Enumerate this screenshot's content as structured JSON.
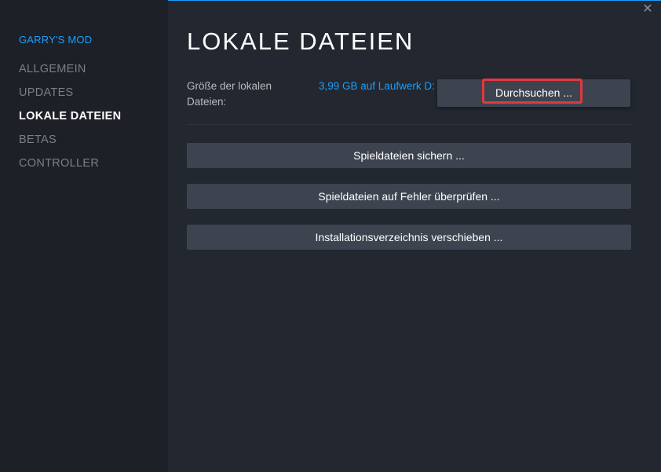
{
  "window": {
    "close_glyph": "✕"
  },
  "sidebar": {
    "game_title": "GARRY'S MOD",
    "items": [
      {
        "label": "ALLGEMEIN",
        "active": false
      },
      {
        "label": "UPDATES",
        "active": false
      },
      {
        "label": "LOKALE DATEIEN",
        "active": true
      },
      {
        "label": "BETAS",
        "active": false
      },
      {
        "label": "CONTROLLER",
        "active": false
      }
    ]
  },
  "main": {
    "title": "LOKALE DATEIEN",
    "size_label": "Größe der lokalen Dateien:",
    "size_value": "3,99 GB auf Laufwerk D:",
    "browse_label": "Durchsuchen ...",
    "actions": [
      {
        "label": "Spieldateien sichern ..."
      },
      {
        "label": "Spieldateien auf Fehler überprüfen ..."
      },
      {
        "label": "Installationsverzeichnis verschieben ..."
      }
    ]
  },
  "colors": {
    "accent": "#1a9fff",
    "sidebar_bg": "#1d2027",
    "content_bg": "#23272f",
    "button_bg": "#3d4450",
    "highlight": "#e03a3e"
  }
}
